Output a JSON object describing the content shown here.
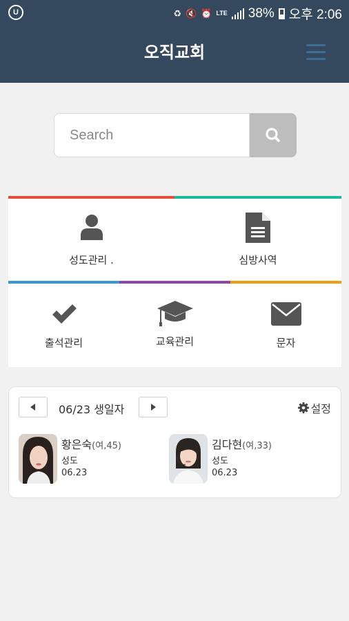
{
  "status_bar": {
    "carrier_icon": "carrier-u-icon",
    "carrier_glyph": "U",
    "network_type": "LTE",
    "battery_percent": "38%",
    "time": "오후 2:06"
  },
  "header": {
    "title": "오직교회",
    "menu_icon": "hamburger-icon"
  },
  "search": {
    "placeholder": "Search",
    "value": "",
    "button_icon": "search-icon"
  },
  "menu": {
    "colors": {
      "red": "#e74c3c",
      "teal": "#1abc9c",
      "blue": "#3498db",
      "purple": "#8e44ad",
      "orange": "#f39c12"
    },
    "items": [
      {
        "label": "성도관리 .",
        "icon": "person-icon"
      },
      {
        "label": "심방사역",
        "icon": "document-icon"
      },
      {
        "label": "출석관리",
        "icon": "checkmark-icon"
      },
      {
        "label": "교육관리",
        "icon": "graduation-cap-icon"
      },
      {
        "label": "문자",
        "icon": "envelope-icon"
      }
    ]
  },
  "birthday": {
    "title": "06/23 생일자",
    "settings_label": "설정",
    "people": [
      {
        "name": "황은숙",
        "meta": "(여,45)",
        "role": "성도",
        "date": "06.23"
      },
      {
        "name": "김다현",
        "meta": "(여,33)",
        "role": "성도",
        "date": "06.23"
      }
    ]
  }
}
